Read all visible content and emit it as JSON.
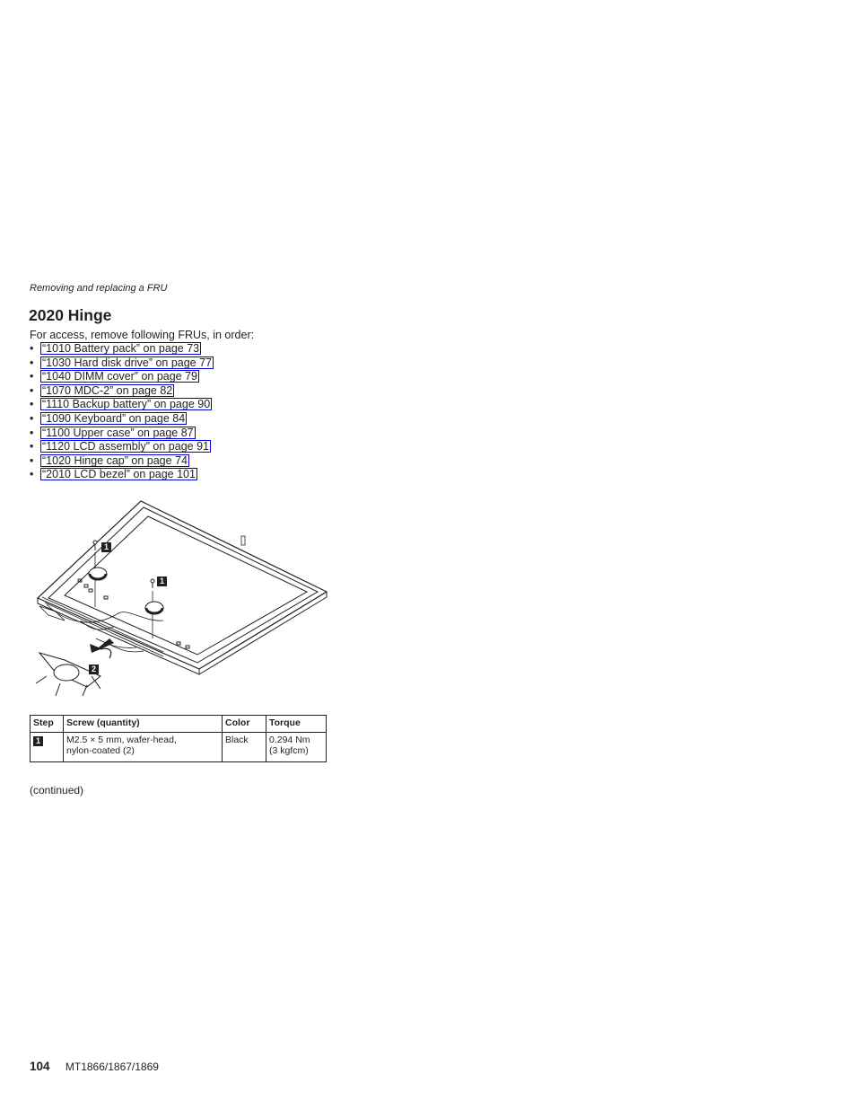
{
  "running_head": "Removing and replacing a FRU",
  "title": "2020 Hinge",
  "intro": "For access, remove following FRUs, in order:",
  "bullet": "•",
  "links": [
    {
      "label": "“1010 Battery pack” on page 73"
    },
    {
      "label": "“1030 Hard disk drive” on page 77"
    },
    {
      "label": "“1040 DIMM cover” on page 79"
    },
    {
      "label": "“1070 MDC-2” on page 82"
    },
    {
      "label": "“1110 Backup battery” on page 90"
    },
    {
      "label": "“1090 Keyboard” on page 84"
    },
    {
      "label": "“1100 Upper case” on page 87"
    },
    {
      "label": "“1120 LCD assembly” on page 91"
    },
    {
      "label": "“1020 Hinge cap” on page 74"
    },
    {
      "label": "“2010 LCD bezel” on page 101"
    }
  ],
  "figure": {
    "callouts": [
      "1",
      "1",
      "2"
    ]
  },
  "table": {
    "headers": [
      "Step",
      "Screw (quantity)",
      "Color",
      "Torque"
    ],
    "rows": [
      {
        "step": "1",
        "screw_line1": "M2.5 × 5 mm, wafer-head,",
        "screw_line2": "nylon-coated (2)",
        "color": "Black",
        "torque_line1": "0.294 Nm",
        "torque_line2": "(3 kgfcm)"
      }
    ]
  },
  "continued": "(continued)",
  "footer": {
    "page_number": "104",
    "model": "MT1866/1867/1869"
  },
  "colors": {
    "link_border": "#0000e0",
    "text": "#231f20"
  }
}
